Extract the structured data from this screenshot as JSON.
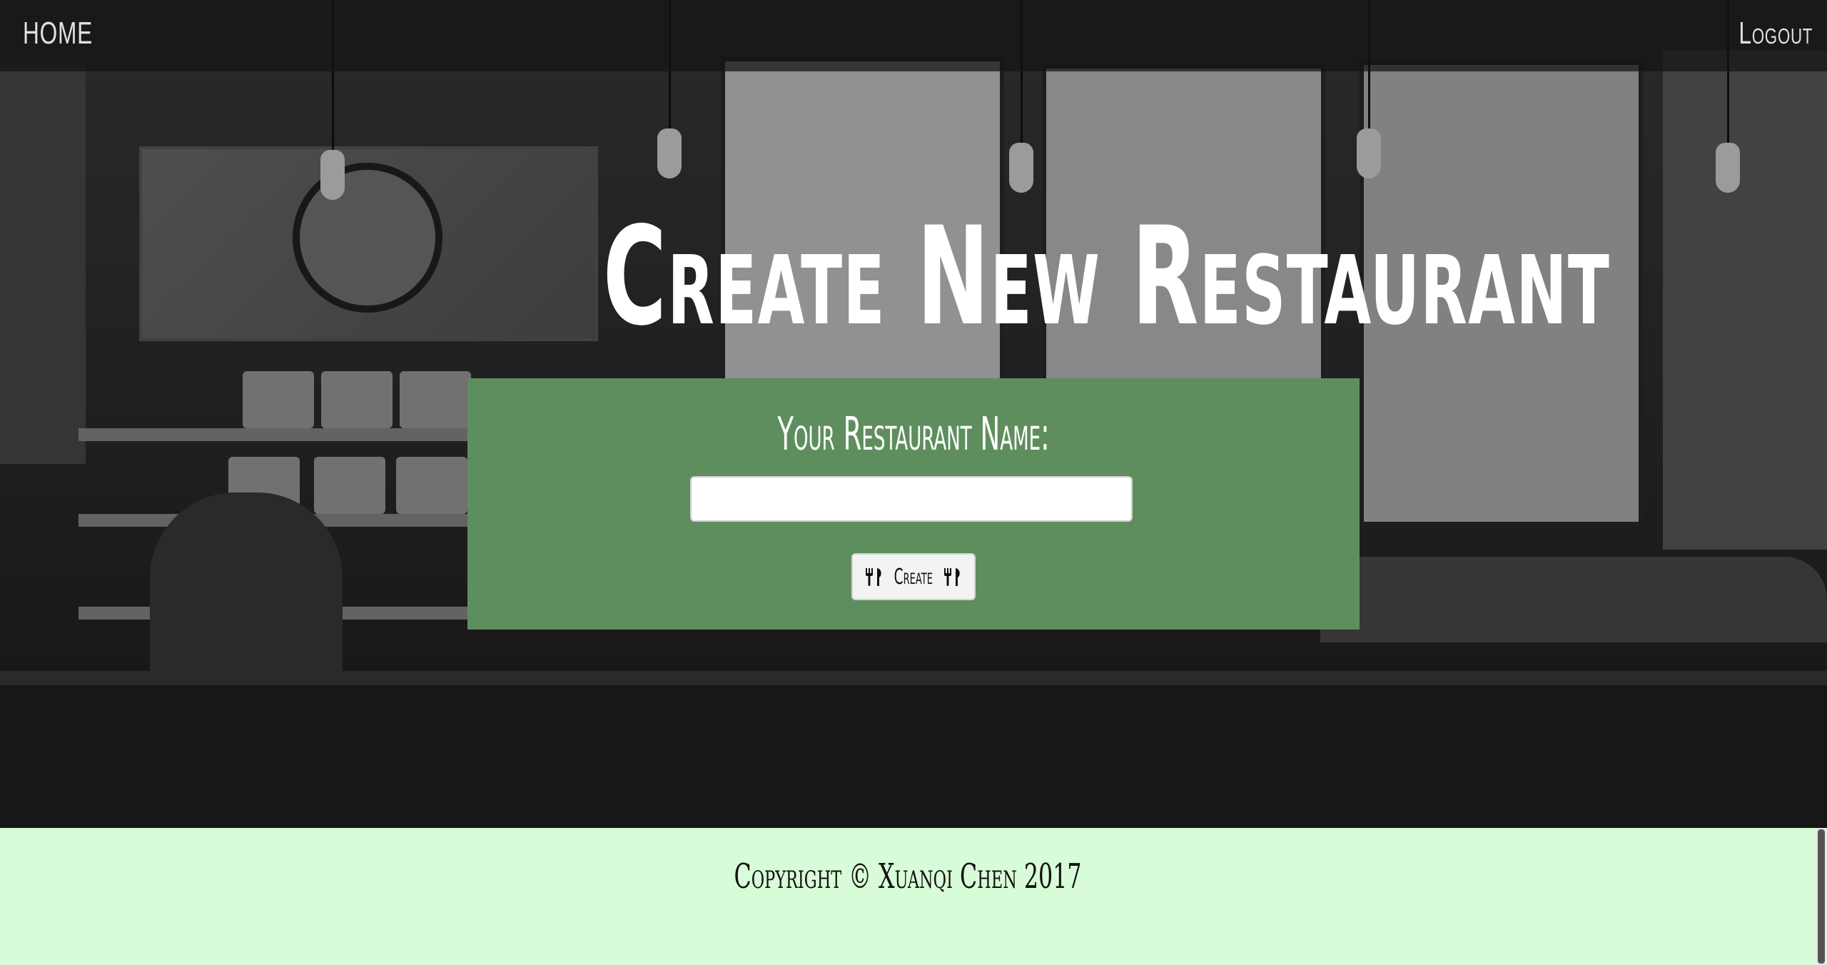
{
  "nav": {
    "home_label": "HOME",
    "logout_label": "Logout"
  },
  "page": {
    "title": "Create New Restaurant"
  },
  "form": {
    "name_label": "Your Restaurant Name:",
    "name_value": "",
    "name_placeholder": "",
    "create_label": "Create",
    "button_icon": "cutlery-icon"
  },
  "footer": {
    "copyright": "Copyright © Xuanqi Chen 2017"
  },
  "colors": {
    "form_panel": "#5f8e5e",
    "footer_bg": "#d8fcd7",
    "navbar_bg": "#141414"
  }
}
